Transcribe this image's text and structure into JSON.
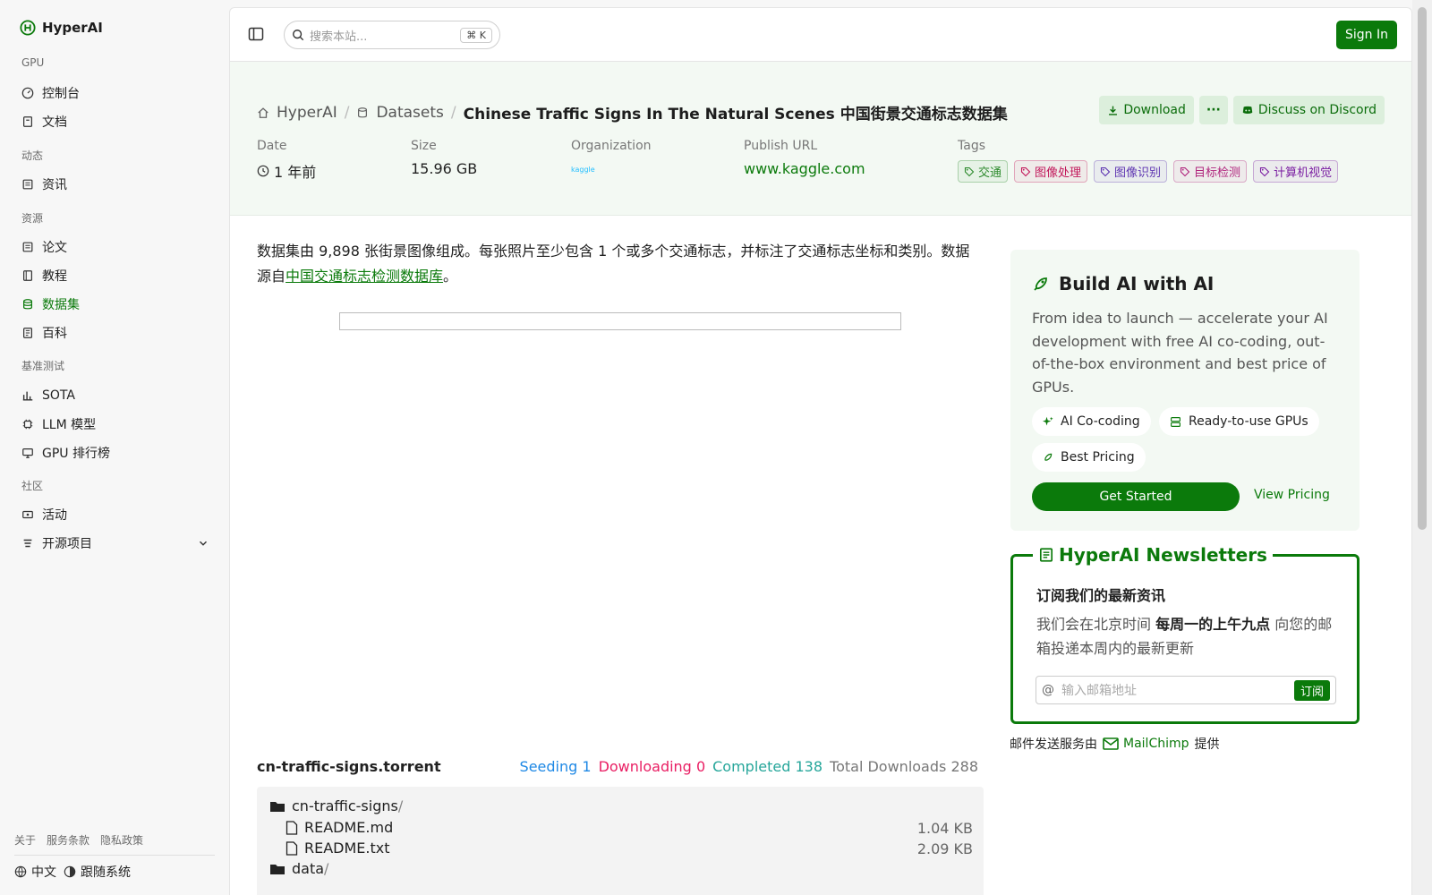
{
  "brand": {
    "name": "HyperAI"
  },
  "sidebar": {
    "sections": [
      {
        "label": "GPU",
        "items": [
          "控制台",
          "文档"
        ]
      },
      {
        "label": "动态",
        "items": [
          "资讯"
        ]
      },
      {
        "label": "资源",
        "items": [
          "论文",
          "教程",
          "数据集",
          "百科"
        ]
      },
      {
        "label": "基准测试",
        "items": [
          "SOTA",
          "LLM 模型",
          "GPU 排行榜"
        ]
      },
      {
        "label": "社区",
        "items": [
          "活动",
          "开源项目"
        ]
      }
    ],
    "active_item": "数据集",
    "footer_links": [
      "关于",
      "服务条款",
      "隐私政策"
    ],
    "language": "中文",
    "theme": "跟随系统"
  },
  "topbar": {
    "search_placeholder": "搜索本站...",
    "shortcut": "K",
    "signin": "Sign In"
  },
  "breadcrumb": {
    "home": "HyperAI",
    "section": "Datasets",
    "current": "Chinese Traffic Signs In The Natural Scenes 中国街景交通标志数据集"
  },
  "actions": {
    "download": "Download",
    "more": "···",
    "discord": "Discuss on Discord"
  },
  "meta": {
    "date_label": "Date",
    "date_value": "1 年前",
    "size_label": "Size",
    "size_value": "15.96 GB",
    "org_label": "Organization",
    "org_logo": "kaggle",
    "url_label": "Publish URL",
    "url_value": "www.kaggle.com",
    "tags_label": "Tags",
    "tags": [
      {
        "text": "交通",
        "color": "#2e8b2e"
      },
      {
        "text": "图像处理",
        "color": "#c2185b"
      },
      {
        "text": "图像识别",
        "color": "#5e35b1"
      },
      {
        "text": "目标检测",
        "color": "#b0257d"
      },
      {
        "text": "计算机视觉",
        "color": "#7b1fa2"
      }
    ]
  },
  "description": {
    "text": "数据集由 9,898 张街景图像组成。每张照片至少包含 1 个或多个交通标志，并标注了交通标志坐标和类别。数据源自",
    "link": "中国交通标志检测数据库",
    "end": "。"
  },
  "torrent": {
    "name": "cn-traffic-signs.torrent",
    "seeding_label": "Seeding",
    "seeding": "1",
    "downloading_label": "Downloading",
    "downloading": "0",
    "completed_label": "Completed",
    "completed": "138",
    "total_label": "Total Downloads",
    "total": "288",
    "files": [
      {
        "name": "cn-traffic-signs",
        "suffix": "/",
        "type": "folder",
        "size": ""
      },
      {
        "name": "README.md",
        "type": "file",
        "size": "1.04 KB"
      },
      {
        "name": "README.txt",
        "type": "file",
        "size": "2.09 KB"
      },
      {
        "name": "data",
        "suffix": "/",
        "type": "folder",
        "size": ""
      }
    ]
  },
  "promo": {
    "title": "Build AI with AI",
    "body": "From idea to launch — accelerate your AI development with free AI co-coding, out-of-the-box environment and best price of GPUs.",
    "pills": [
      "AI Co-coding",
      "Ready-to-use GPUs",
      "Best Pricing"
    ],
    "cta": "Get Started",
    "link": "View Pricing"
  },
  "newsletter": {
    "legend": "HyperAI Newsletters",
    "heading": "订阅我们的最新资讯",
    "p1": "我们会在北京时间 ",
    "bold": "每周一的上午九点",
    "p2": " 向您的邮箱投递本周内的最新更新",
    "email_placeholder": "输入邮箱地址",
    "subscribe": "订阅",
    "footer_pre": "邮件发送服务由",
    "footer_brand": "MailChimp",
    "footer_post": "提供"
  },
  "colors": {
    "accent": "#0b7a0b",
    "seeding": "#1e88e5",
    "downloading": "#e91e63",
    "completed": "#26a69a"
  }
}
